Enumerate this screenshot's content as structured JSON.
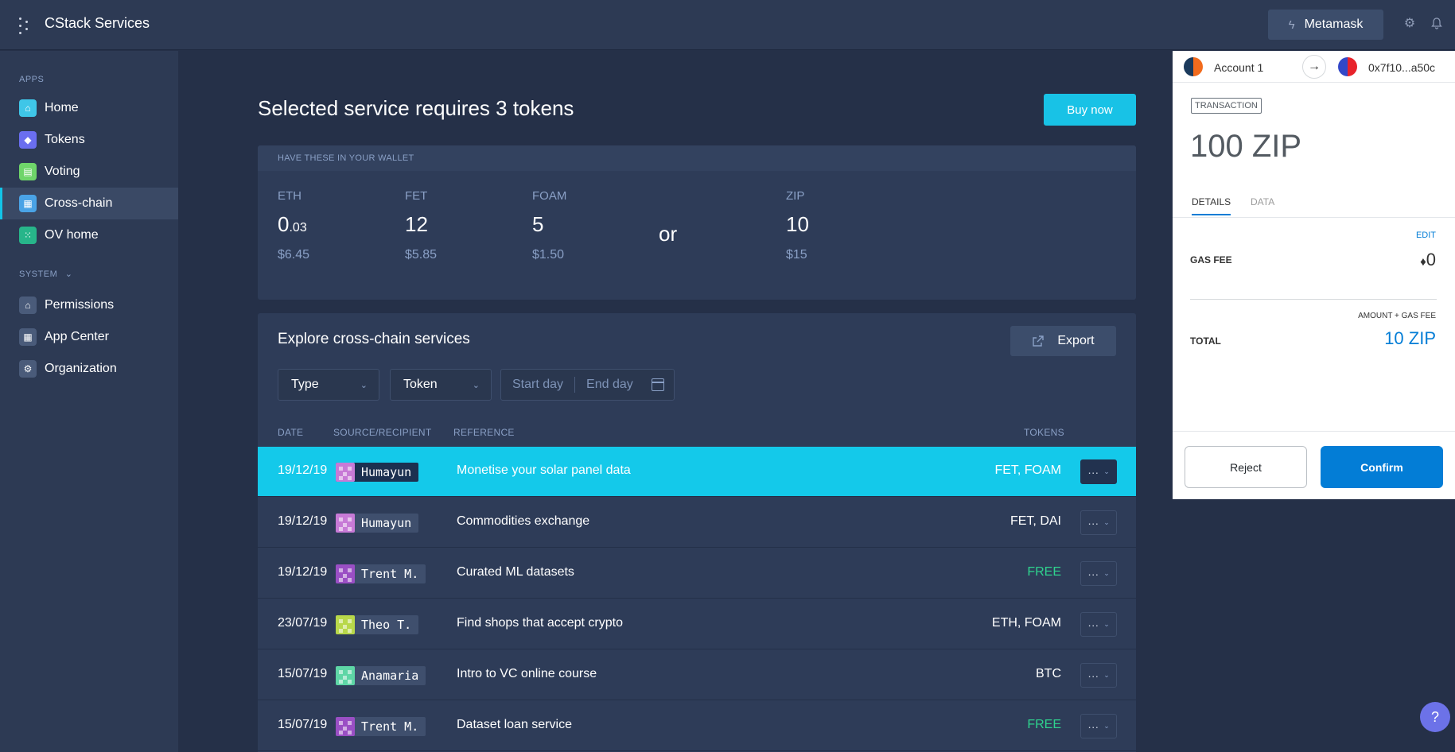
{
  "header": {
    "app_name": "CStack Services",
    "metamask_label": "Metamask",
    "settings_icon": "gear-icon",
    "notifications_icon": "bell-icon"
  },
  "sidebar": {
    "apps_heading": "APPS",
    "apps": [
      {
        "label": "Home",
        "icon": "home-icon",
        "color": "#3fc6e8"
      },
      {
        "label": "Tokens",
        "icon": "cube-icon",
        "color": "#6a6ef0"
      },
      {
        "label": "Voting",
        "icon": "vote-icon",
        "color": "#6fd56a"
      },
      {
        "label": "Cross-chain",
        "icon": "calculator-icon",
        "color": "#4aa3e6"
      },
      {
        "label": "OV home",
        "icon": "dots-icon",
        "color": "#27b58a"
      }
    ],
    "system_heading": "SYSTEM",
    "system": [
      {
        "label": "Permissions",
        "icon": "bank-icon"
      },
      {
        "label": "App Center",
        "icon": "grid-icon"
      },
      {
        "label": "Organization",
        "icon": "gear-icon"
      }
    ],
    "active": "Cross-chain"
  },
  "main": {
    "title": "Selected service requires 3 tokens",
    "buy_label": "Buy now",
    "wallet": {
      "heading": "HAVE THESE IN YOUR WALLET",
      "tokens": [
        {
          "symbol": "ETH",
          "amount_int": "0",
          "amount_frac": ".03",
          "usd": "$6.45"
        },
        {
          "symbol": "FET",
          "amount_int": "12",
          "amount_frac": "",
          "usd": "$5.85"
        },
        {
          "symbol": "FOAM",
          "amount_int": "5",
          "amount_frac": "",
          "usd": "$1.50"
        },
        {
          "symbol": "ZIP",
          "amount_int": "10",
          "amount_frac": "",
          "usd": "$15"
        }
      ],
      "or_word": "or"
    },
    "explore": {
      "title": "Explore cross-chain services",
      "export_label": "Export",
      "filters": {
        "type": "Type",
        "token": "Token",
        "start_placeholder": "Start day",
        "end_placeholder": "End day"
      },
      "columns": {
        "date": "DATE",
        "source": "SOURCE/RECIPIENT",
        "reference": "REFERENCE",
        "tokens": "TOKENS"
      },
      "rows": [
        {
          "date": "19/12/19",
          "user": "Humayun",
          "avatar_color": "#c77ad6",
          "reference": "Monetise your solar panel data",
          "tokens": "FET, FOAM",
          "free": false,
          "selected": true
        },
        {
          "date": "19/12/19",
          "user": "Humayun",
          "avatar_color": "#c77ad6",
          "reference": "Commodities exchange",
          "tokens": "FET, DAI",
          "free": false,
          "selected": false
        },
        {
          "date": "19/12/19",
          "user": "Trent M.",
          "avatar_color": "#9a4fc4",
          "reference": "Curated ML datasets",
          "tokens": "FREE",
          "free": true,
          "selected": false
        },
        {
          "date": "23/07/19",
          "user": "Theo T.",
          "avatar_color": "#b8d84a",
          "reference": "Find shops that accept crypto",
          "tokens": "ETH, FOAM",
          "free": false,
          "selected": false
        },
        {
          "date": "15/07/19",
          "user": "Anamaria",
          "avatar_color": "#5ed6a6",
          "reference": "Intro to VC online course",
          "tokens": "BTC",
          "free": false,
          "selected": false
        },
        {
          "date": "15/07/19",
          "user": "Trent M.",
          "avatar_color": "#9a4fc4",
          "reference": "Dataset loan service",
          "tokens": "FREE",
          "free": true,
          "selected": false
        }
      ]
    }
  },
  "metamask": {
    "account_name": "Account 1",
    "address": "0x7f10...a50c",
    "tx_badge": "TRANSACTION",
    "amount": "100 ZIP",
    "tabs": [
      "DETAILS",
      "DATA"
    ],
    "edit_label": "EDIT",
    "gas_fee_label": "GAS FEE",
    "gas_fee_symbol": "♦",
    "gas_fee_value": "0",
    "amount_gas_label": "AMOUNT + GAS FEE",
    "total_label": "TOTAL",
    "total_value": "10 ZIP",
    "reject_label": "Reject",
    "confirm_label": "Confirm"
  },
  "help_label": "?"
}
